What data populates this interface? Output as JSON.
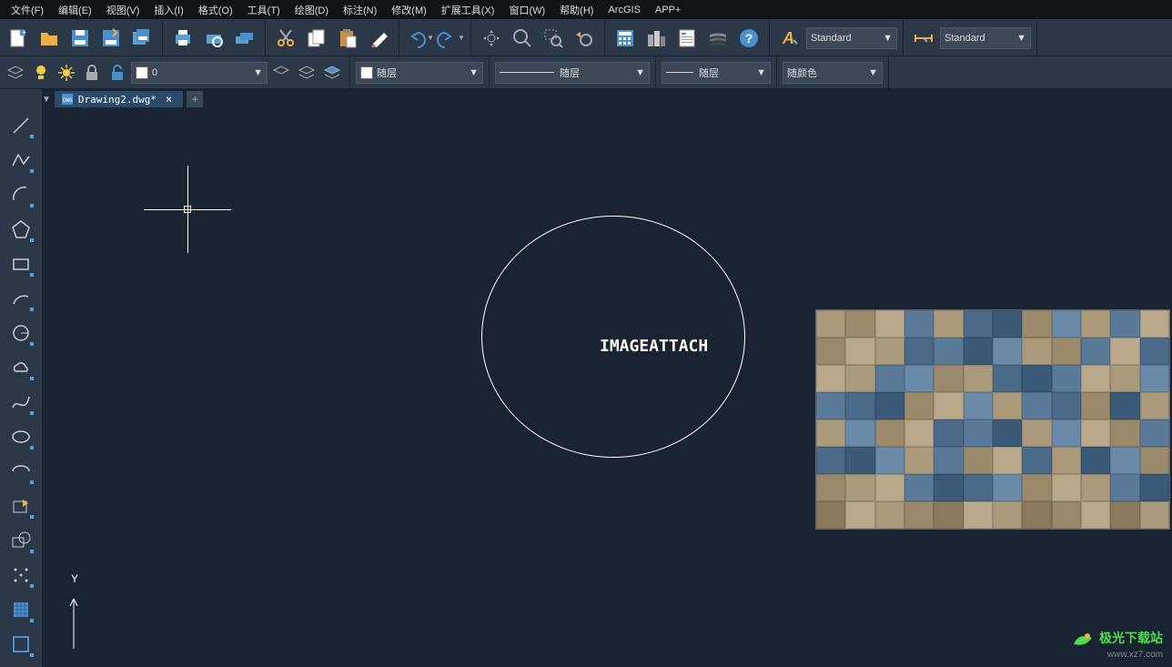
{
  "menubar": {
    "items": [
      {
        "label": "文件(F)"
      },
      {
        "label": "编辑(E)"
      },
      {
        "label": "视图(V)"
      },
      {
        "label": "插入(I)"
      },
      {
        "label": "格式(O)"
      },
      {
        "label": "工具(T)"
      },
      {
        "label": "绘图(D)"
      },
      {
        "label": "标注(N)"
      },
      {
        "label": "修改(M)"
      },
      {
        "label": "扩展工具(X)"
      },
      {
        "label": "窗口(W)"
      },
      {
        "label": "帮助(H)"
      },
      {
        "label": "ArcGIS"
      },
      {
        "label": "APP+"
      }
    ]
  },
  "toolbar1": {
    "icons": [
      "new",
      "open",
      "save",
      "saveall",
      "copy",
      "print",
      "printprev",
      "printbatch",
      "cut",
      "copyclip",
      "paste",
      "erase",
      "undo",
      "redo",
      "pan",
      "zoom",
      "zoomwin",
      "zoombck",
      "grid",
      "table",
      "props",
      "help",
      "help-q",
      "text",
      "textdd",
      "dim",
      "dimdd"
    ],
    "text_style": "Standard",
    "dim_style": "Standard"
  },
  "toolbar2": {
    "layer_value": "0",
    "color_label": "随层",
    "linetype_label": "随层",
    "lineweight_label": "随层",
    "plotstyle_label": "随颜色"
  },
  "tab": {
    "name": "Drawing2.dwg*"
  },
  "canvas": {
    "text": "IMAGEATTACH"
  },
  "left_tools": [
    "line",
    "pline",
    "curve",
    "polygon",
    "rect",
    "arc",
    "circle",
    "cloud",
    "spline",
    "ellipse",
    "earc",
    "block",
    "region",
    "point",
    "hatch",
    "rect2"
  ],
  "watermark": {
    "main": "极光下载站",
    "sub": "www.xz7.com"
  },
  "ucs": {
    "y": "Y",
    "x_arrow": "↑"
  }
}
